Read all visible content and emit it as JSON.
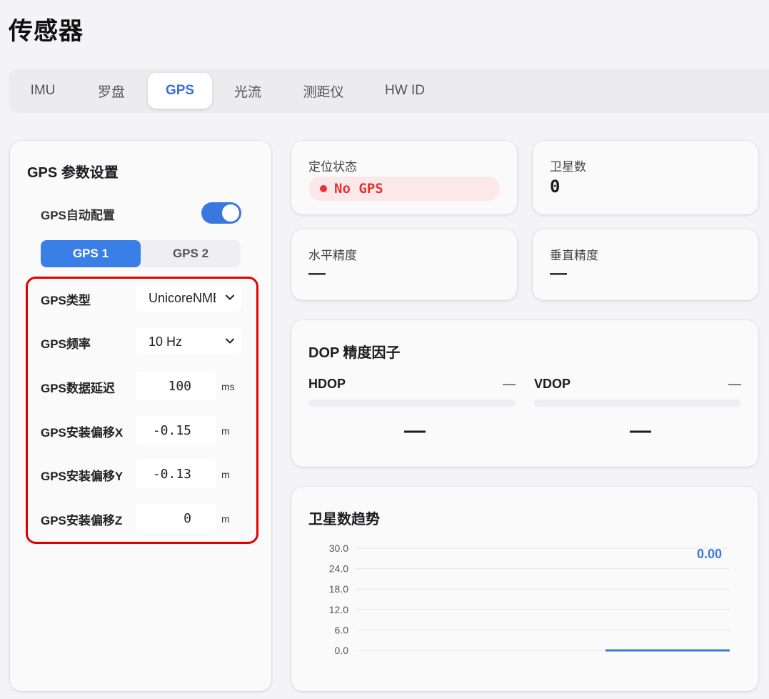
{
  "page": {
    "title": "传感器"
  },
  "tabs": [
    {
      "label": "IMU",
      "active": false
    },
    {
      "label": "罗盘",
      "active": false
    },
    {
      "label": "GPS",
      "active": true
    },
    {
      "label": "光流",
      "active": false
    },
    {
      "label": "测距仪",
      "active": false
    },
    {
      "label": "HW ID",
      "active": false
    }
  ],
  "gps_settings": {
    "title": "GPS 参数设置",
    "auto_config_label": "GPS自动配置",
    "auto_config_on": true,
    "subtabs": [
      "GPS 1",
      "GPS 2"
    ],
    "active_subtab": "GPS 1",
    "type_label": "GPS类型",
    "type_value": "UnicoreNMEA",
    "rate_label": "GPS频率",
    "rate_value": "10 Hz",
    "delay_label": "GPS数据延迟",
    "delay_value": "100",
    "delay_unit": "ms",
    "offset_x_label": "GPS安装偏移X",
    "offset_x_value": "-0.15",
    "offset_y_label": "GPS安装偏移Y",
    "offset_y_value": "-0.13",
    "offset_z_label": "GPS安装偏移Z",
    "offset_z_value": "0",
    "offset_unit": "m"
  },
  "status": {
    "fix_label": "定位状态",
    "fix_value": "No GPS",
    "fix_color": "#e53333",
    "sats_label": "卫星数",
    "sats_value": "0",
    "hacc_label": "水平精度",
    "hacc_value": "—",
    "vacc_label": "垂直精度",
    "vacc_value": "—"
  },
  "dop": {
    "title": "DOP 精度因子",
    "hdop_label": "HDOP",
    "hdop_value": "—",
    "hdop_big": "—",
    "vdop_label": "VDOP",
    "vdop_value": "—",
    "vdop_big": "—"
  },
  "trend": {
    "title": "卫星数趋势",
    "current_value": "0.00"
  },
  "colors": {
    "accent": "#3a78e0",
    "error": "#e53333",
    "highlight_border": "#e10000"
  },
  "chart_data": {
    "type": "line",
    "title": "卫星数趋势",
    "xlabel": "",
    "ylabel": "",
    "yticks": [
      "30.0",
      "24.0",
      "18.0",
      "12.0",
      "6.0",
      "0.0"
    ],
    "ylim": [
      0,
      30
    ],
    "grid": true,
    "series": [
      {
        "values": [
          0,
          0,
          0,
          0,
          0,
          0
        ],
        "color": "#3a78e0"
      }
    ]
  }
}
